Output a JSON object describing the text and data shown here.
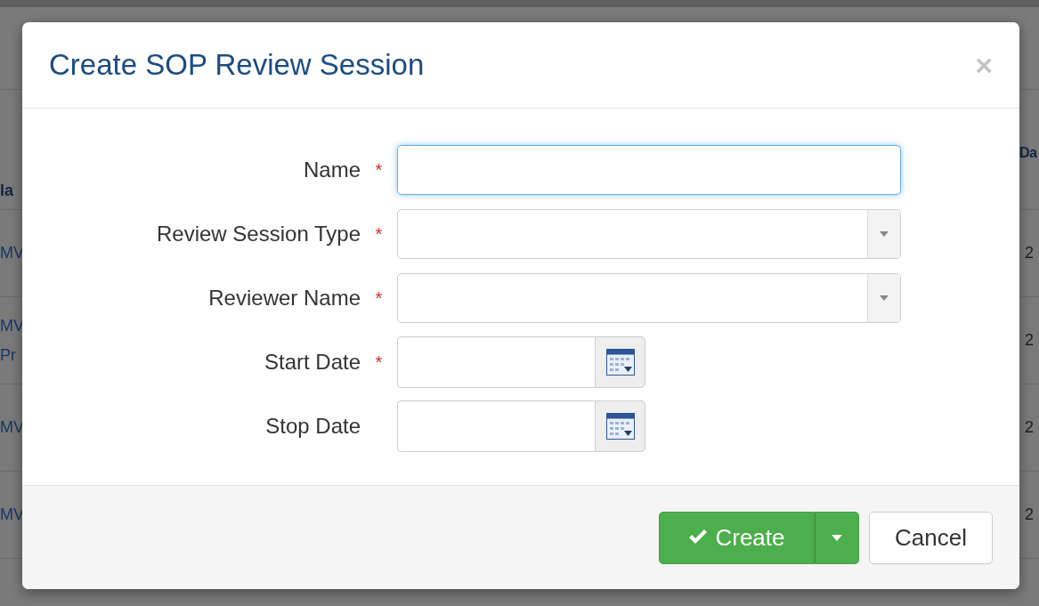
{
  "background_table": {
    "header": {
      "column_1": "la",
      "column_2": "Da"
    },
    "rows": [
      {
        "column_1": [
          "MV"
        ],
        "column_2": "2"
      },
      {
        "column_1": [
          "MV",
          "Pr"
        ],
        "column_2": "2"
      },
      {
        "column_1": [
          "MV"
        ],
        "column_2": "2"
      },
      {
        "column_1": [
          "MV"
        ],
        "column_2": "2"
      }
    ]
  },
  "dialog": {
    "title": "Create SOP Review Session",
    "close": "×",
    "fields": [
      {
        "label": "Name",
        "required": true,
        "kind": "text",
        "focused": true
      },
      {
        "label": "Review Session Type",
        "required": true,
        "kind": "select",
        "focused": false
      },
      {
        "label": "Reviewer Name",
        "required": true,
        "kind": "select",
        "focused": false
      },
      {
        "label": "Start Date",
        "required": true,
        "kind": "date",
        "focused": false
      },
      {
        "label": "Stop Date",
        "required": false,
        "kind": "date",
        "focused": false
      }
    ],
    "required_mark": "*",
    "buttons": [
      {
        "label": "Create",
        "kind": "primary"
      },
      {
        "label": "Cancel",
        "kind": "default"
      }
    ]
  }
}
